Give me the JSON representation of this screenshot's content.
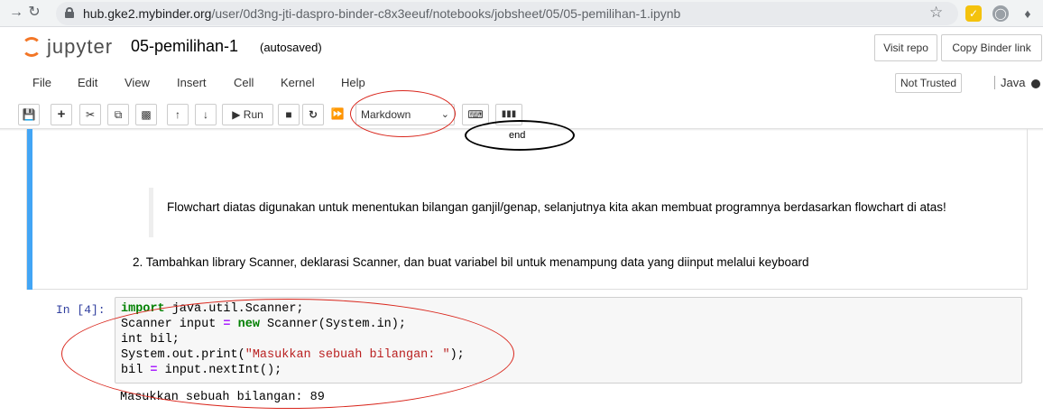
{
  "browser": {
    "url_host": "hub.gke2.mybinder.org",
    "url_path": "/user/0d3ng-jti-daspro-binder-c8x3eeuf/notebooks/jobsheet/05/05-pemilihan-1.ipynb",
    "back_icon": "arrow-right-icon",
    "reload_icon": "reload-icon"
  },
  "header": {
    "logo_text": "jupyter",
    "title": "05-pemilihan-1",
    "status": "(autosaved)",
    "visit_repo": "Visit repo",
    "copy_link": "Copy Binder link"
  },
  "menu": {
    "items": [
      "File",
      "Edit",
      "View",
      "Insert",
      "Cell",
      "Kernel",
      "Help"
    ],
    "trust": "Not Trusted",
    "kernel": "Java"
  },
  "toolbar": {
    "run": "Run",
    "cell_type": "Markdown"
  },
  "markdown": {
    "end_label": "end",
    "quote": "Flowchart diatas digunakan untuk menentukan bilangan ganjil/genap, selanjutnya kita akan membuat programnya berdasarkan flowchart di atas!",
    "step": "2. Tambahkan library Scanner, deklarasi Scanner, dan buat variabel bil untuk menampung data yang diinput melalui keyboard"
  },
  "code_cell": {
    "prompt": "In [4]:",
    "lines": [
      "import java.util.Scanner;",
      "Scanner input = new Scanner(System.in);",
      "int bil;",
      "System.out.print(\"Masukkan sebuah bilangan: \");",
      "bil = input.nextInt();"
    ],
    "output": "Masukkan sebuah bilangan: 89"
  },
  "colors": {
    "accent_blue": "#42a5f5",
    "annotation_red": "#d9261c",
    "jupyter_orange": "#f37626"
  }
}
